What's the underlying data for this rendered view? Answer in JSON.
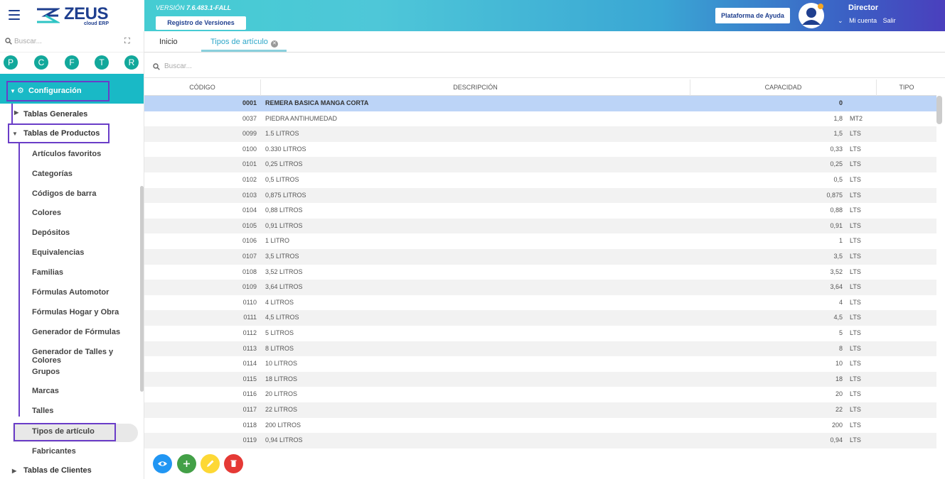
{
  "header": {
    "logo_text": "ZEUS",
    "logo_sub": "cloud ERP",
    "version_prefix": "VERSIÓN",
    "version_number": "7.6.483.1-FALL",
    "registro_label": "Registro de Versiones",
    "help_label": "Plataforma de Ayuda",
    "user_name": "Director",
    "mi_cuenta": "Mi cuenta",
    "salir": "Salir"
  },
  "sidebar": {
    "search_placeholder": "Buscar...",
    "letters": [
      "P",
      "C",
      "F",
      "T",
      "R"
    ],
    "configuracion": "Configuración",
    "tablas_generales": "Tablas Generales",
    "tablas_productos": "Tablas de Productos",
    "sub_items": [
      "Artículos favoritos",
      "Categorías",
      "Códigos de barra",
      "Colores",
      "Depósitos",
      "Equivalencias",
      "Familias",
      "Fórmulas Automotor",
      "Fórmulas Hogar y Obra",
      "Generador de Fórmulas",
      "Generador de Talles y Colores",
      "Grupos",
      "Marcas",
      "Talles",
      "Tipos de artículo",
      "Fabricantes"
    ],
    "tablas_clientes": "Tablas de Clientes"
  },
  "tabs": {
    "inicio": "Inicio",
    "tipos": "Tipos de artículo"
  },
  "main": {
    "search_placeholder": "Buscar...",
    "columns": [
      "CÓDIGO",
      "DESCRIPCIÓN",
      "CAPACIDAD",
      "TIPO"
    ],
    "rows": [
      {
        "code": "0001",
        "desc": "REMERA BASICA MANGA CORTA",
        "cap": "0",
        "tipo": ""
      },
      {
        "code": "0037",
        "desc": "PIEDRA ANTIHUMEDAD",
        "cap": "1,8",
        "tipo": "MT2"
      },
      {
        "code": "0099",
        "desc": "1.5 LITROS",
        "cap": "1,5",
        "tipo": "LTS"
      },
      {
        "code": "0100",
        "desc": "0.330 LITROS",
        "cap": "0,33",
        "tipo": "LTS"
      },
      {
        "code": "0101",
        "desc": "0,25 LITROS",
        "cap": "0,25",
        "tipo": "LTS"
      },
      {
        "code": "0102",
        "desc": "0,5 LITROS",
        "cap": "0,5",
        "tipo": "LTS"
      },
      {
        "code": "0103",
        "desc": "0,875 LITROS",
        "cap": "0,875",
        "tipo": "LTS"
      },
      {
        "code": "0104",
        "desc": "0,88 LITROS",
        "cap": "0,88",
        "tipo": "LTS"
      },
      {
        "code": "0105",
        "desc": "0,91 LITROS",
        "cap": "0,91",
        "tipo": "LTS"
      },
      {
        "code": "0106",
        "desc": "1 LITRO",
        "cap": "1",
        "tipo": "LTS"
      },
      {
        "code": "0107",
        "desc": "3,5 LITROS",
        "cap": "3,5",
        "tipo": "LTS"
      },
      {
        "code": "0108",
        "desc": "3,52 LITROS",
        "cap": "3,52",
        "tipo": "LTS"
      },
      {
        "code": "0109",
        "desc": "3,64 LITROS",
        "cap": "3,64",
        "tipo": "LTS"
      },
      {
        "code": "0110",
        "desc": "4 LITROS",
        "cap": "4",
        "tipo": "LTS"
      },
      {
        "code": "0111",
        "desc": "4,5 LITROS",
        "cap": "4,5",
        "tipo": "LTS"
      },
      {
        "code": "0112",
        "desc": "5 LITROS",
        "cap": "5",
        "tipo": "LTS"
      },
      {
        "code": "0113",
        "desc": "8 LITROS",
        "cap": "8",
        "tipo": "LTS"
      },
      {
        "code": "0114",
        "desc": "10 LITROS",
        "cap": "10",
        "tipo": "LTS"
      },
      {
        "code": "0115",
        "desc": "18 LITROS",
        "cap": "18",
        "tipo": "LTS"
      },
      {
        "code": "0116",
        "desc": "20 LITROS",
        "cap": "20",
        "tipo": "LTS"
      },
      {
        "code": "0117",
        "desc": "22 LITROS",
        "cap": "22",
        "tipo": "LTS"
      },
      {
        "code": "0118",
        "desc": "200 LITROS",
        "cap": "200",
        "tipo": "LTS"
      },
      {
        "code": "0119",
        "desc": "0,94 LITROS",
        "cap": "0,94",
        "tipo": "LTS"
      }
    ]
  },
  "actions": {
    "view_color": "#2196f3",
    "add_color": "#43a047",
    "edit_color": "#fdd835",
    "delete_color": "#e53935"
  }
}
